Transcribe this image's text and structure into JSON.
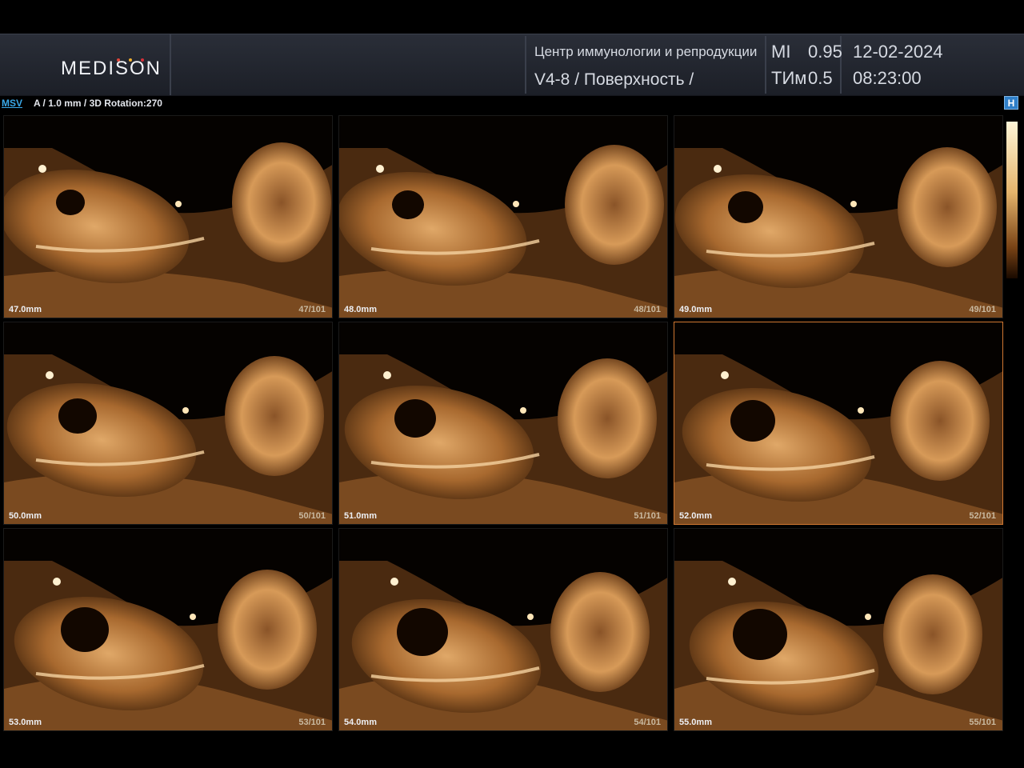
{
  "header": {
    "logo_text": "MEDISON",
    "logo_dot_colors": [
      "#e0453a",
      "#f0b030",
      "#d6303a"
    ],
    "institution": "Центр иммунологии и репродукции",
    "probe_mode": "V4-8 / Поверхность /",
    "mi_label": "MI",
    "mi_value": "0.95",
    "ti_label": "ТИм",
    "ti_value": "0.5",
    "date": "12-02-2024",
    "time": "08:23:00"
  },
  "infobar": {
    "mode_label": "MSV",
    "params": "A / 1.0 mm / 3D Rotation:270",
    "h_button": "H"
  },
  "colors": {
    "accent": "#3aa8e8",
    "tissue": "#c88a4a",
    "selected_border": "#d07832"
  },
  "slices": [
    {
      "depth": "47.0mm",
      "index": "47/101"
    },
    {
      "depth": "48.0mm",
      "index": "48/101"
    },
    {
      "depth": "49.0mm",
      "index": "49/101"
    },
    {
      "depth": "50.0mm",
      "index": "50/101"
    },
    {
      "depth": "51.0mm",
      "index": "51/101"
    },
    {
      "depth": "52.0mm",
      "index": "52/101"
    },
    {
      "depth": "53.0mm",
      "index": "53/101"
    },
    {
      "depth": "54.0mm",
      "index": "54/101"
    },
    {
      "depth": "55.0mm",
      "index": "55/101"
    }
  ],
  "selected_slice": 5
}
